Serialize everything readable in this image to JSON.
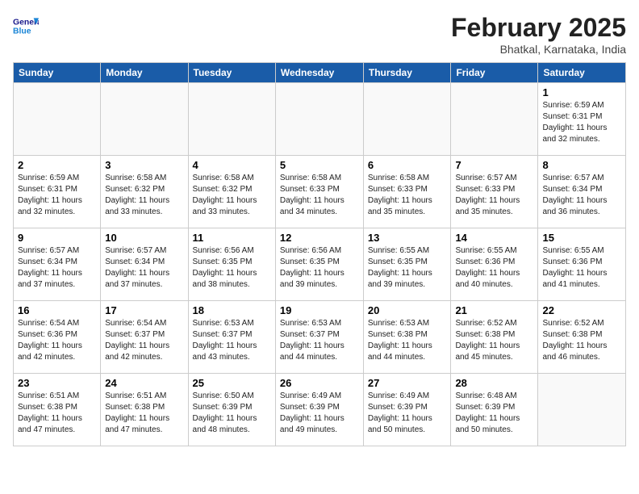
{
  "logo": {
    "general": "General",
    "blue": "Blue"
  },
  "header": {
    "month_year": "February 2025",
    "location": "Bhatkal, Karnataka, India"
  },
  "weekdays": [
    "Sunday",
    "Monday",
    "Tuesday",
    "Wednesday",
    "Thursday",
    "Friday",
    "Saturday"
  ],
  "weeks": [
    [
      {
        "day": "",
        "info": ""
      },
      {
        "day": "",
        "info": ""
      },
      {
        "day": "",
        "info": ""
      },
      {
        "day": "",
        "info": ""
      },
      {
        "day": "",
        "info": ""
      },
      {
        "day": "",
        "info": ""
      },
      {
        "day": "1",
        "info": "Sunrise: 6:59 AM\nSunset: 6:31 PM\nDaylight: 11 hours\nand 32 minutes."
      }
    ],
    [
      {
        "day": "2",
        "info": "Sunrise: 6:59 AM\nSunset: 6:31 PM\nDaylight: 11 hours\nand 32 minutes."
      },
      {
        "day": "3",
        "info": "Sunrise: 6:58 AM\nSunset: 6:32 PM\nDaylight: 11 hours\nand 33 minutes."
      },
      {
        "day": "4",
        "info": "Sunrise: 6:58 AM\nSunset: 6:32 PM\nDaylight: 11 hours\nand 33 minutes."
      },
      {
        "day": "5",
        "info": "Sunrise: 6:58 AM\nSunset: 6:33 PM\nDaylight: 11 hours\nand 34 minutes."
      },
      {
        "day": "6",
        "info": "Sunrise: 6:58 AM\nSunset: 6:33 PM\nDaylight: 11 hours\nand 35 minutes."
      },
      {
        "day": "7",
        "info": "Sunrise: 6:57 AM\nSunset: 6:33 PM\nDaylight: 11 hours\nand 35 minutes."
      },
      {
        "day": "8",
        "info": "Sunrise: 6:57 AM\nSunset: 6:34 PM\nDaylight: 11 hours\nand 36 minutes."
      }
    ],
    [
      {
        "day": "9",
        "info": "Sunrise: 6:57 AM\nSunset: 6:34 PM\nDaylight: 11 hours\nand 37 minutes."
      },
      {
        "day": "10",
        "info": "Sunrise: 6:57 AM\nSunset: 6:34 PM\nDaylight: 11 hours\nand 37 minutes."
      },
      {
        "day": "11",
        "info": "Sunrise: 6:56 AM\nSunset: 6:35 PM\nDaylight: 11 hours\nand 38 minutes."
      },
      {
        "day": "12",
        "info": "Sunrise: 6:56 AM\nSunset: 6:35 PM\nDaylight: 11 hours\nand 39 minutes."
      },
      {
        "day": "13",
        "info": "Sunrise: 6:55 AM\nSunset: 6:35 PM\nDaylight: 11 hours\nand 39 minutes."
      },
      {
        "day": "14",
        "info": "Sunrise: 6:55 AM\nSunset: 6:36 PM\nDaylight: 11 hours\nand 40 minutes."
      },
      {
        "day": "15",
        "info": "Sunrise: 6:55 AM\nSunset: 6:36 PM\nDaylight: 11 hours\nand 41 minutes."
      }
    ],
    [
      {
        "day": "16",
        "info": "Sunrise: 6:54 AM\nSunset: 6:36 PM\nDaylight: 11 hours\nand 42 minutes."
      },
      {
        "day": "17",
        "info": "Sunrise: 6:54 AM\nSunset: 6:37 PM\nDaylight: 11 hours\nand 42 minutes."
      },
      {
        "day": "18",
        "info": "Sunrise: 6:53 AM\nSunset: 6:37 PM\nDaylight: 11 hours\nand 43 minutes."
      },
      {
        "day": "19",
        "info": "Sunrise: 6:53 AM\nSunset: 6:37 PM\nDaylight: 11 hours\nand 44 minutes."
      },
      {
        "day": "20",
        "info": "Sunrise: 6:53 AM\nSunset: 6:38 PM\nDaylight: 11 hours\nand 44 minutes."
      },
      {
        "day": "21",
        "info": "Sunrise: 6:52 AM\nSunset: 6:38 PM\nDaylight: 11 hours\nand 45 minutes."
      },
      {
        "day": "22",
        "info": "Sunrise: 6:52 AM\nSunset: 6:38 PM\nDaylight: 11 hours\nand 46 minutes."
      }
    ],
    [
      {
        "day": "23",
        "info": "Sunrise: 6:51 AM\nSunset: 6:38 PM\nDaylight: 11 hours\nand 47 minutes."
      },
      {
        "day": "24",
        "info": "Sunrise: 6:51 AM\nSunset: 6:38 PM\nDaylight: 11 hours\nand 47 minutes."
      },
      {
        "day": "25",
        "info": "Sunrise: 6:50 AM\nSunset: 6:39 PM\nDaylight: 11 hours\nand 48 minutes."
      },
      {
        "day": "26",
        "info": "Sunrise: 6:49 AM\nSunset: 6:39 PM\nDaylight: 11 hours\nand 49 minutes."
      },
      {
        "day": "27",
        "info": "Sunrise: 6:49 AM\nSunset: 6:39 PM\nDaylight: 11 hours\nand 50 minutes."
      },
      {
        "day": "28",
        "info": "Sunrise: 6:48 AM\nSunset: 6:39 PM\nDaylight: 11 hours\nand 50 minutes."
      },
      {
        "day": "",
        "info": ""
      }
    ]
  ]
}
